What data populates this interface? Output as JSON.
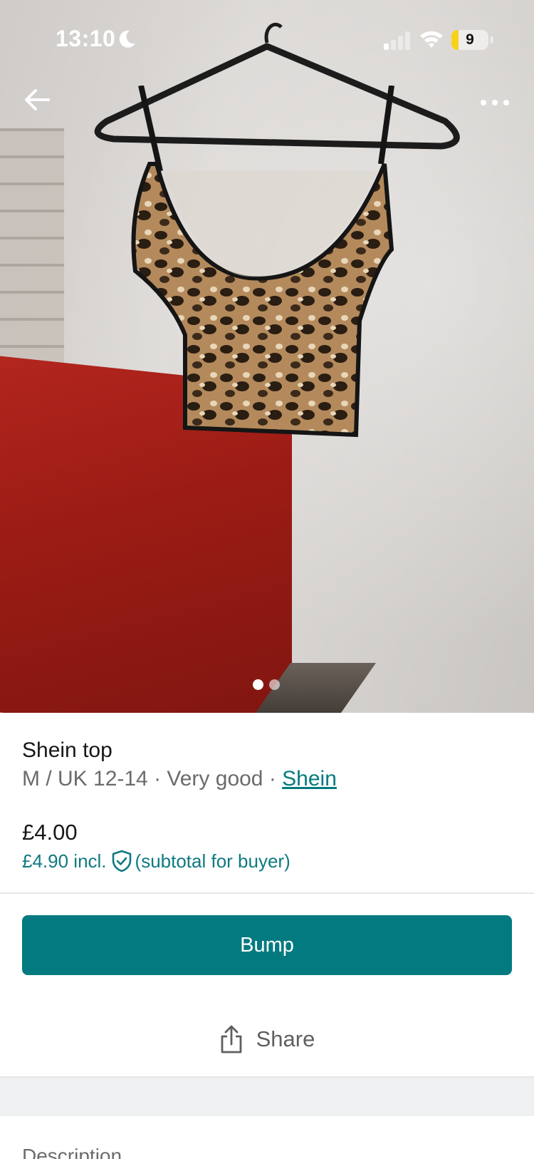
{
  "status_bar": {
    "time": "13:10",
    "battery": "9",
    "battery_fraction": 0.09,
    "accent_battery": "#f6d21c"
  },
  "nav": {
    "back_icon": "arrow-left-icon",
    "more_icon": "more-horizontal-icon"
  },
  "gallery": {
    "image_count": 2,
    "active_index": 0
  },
  "item": {
    "title": "Shein top",
    "size_condition": "M / UK 12-14 · Very good · ",
    "brand": "Shein",
    "price": "£4.00",
    "price_incl": "£4.90 incl.",
    "price_incl_note": "(subtotal for buyer)"
  },
  "actions": {
    "bump_label": "Bump",
    "share_label": "Share"
  },
  "sections": {
    "description_label": "Description"
  },
  "colors": {
    "brand_teal": "#037a80",
    "link_teal": "#027b7f"
  }
}
